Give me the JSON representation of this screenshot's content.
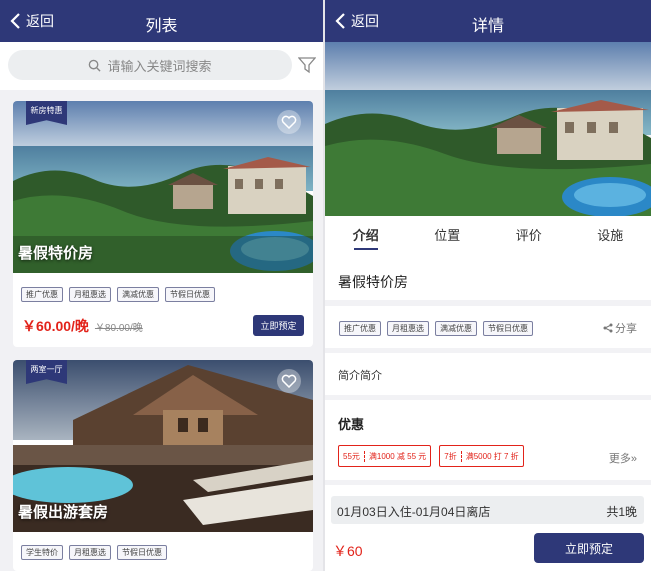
{
  "list_screen": {
    "back_label": "返回",
    "title": "列表",
    "search": {
      "placeholder": "请输入关键词搜索"
    },
    "rooms": [
      {
        "ribbon": "新房特惠",
        "name": "暑假特价房",
        "tags": [
          "推广优惠",
          "月租惠选",
          "满减优惠",
          "节假日优惠"
        ],
        "price": "￥60.00/晚",
        "original_price": "￥80.00/晚",
        "book_label": "立即预定"
      },
      {
        "ribbon": "两室一厅",
        "name": "暑假出游套房",
        "tags": [
          "学生特价",
          "月租惠选",
          "节假日优惠"
        ]
      }
    ]
  },
  "detail_screen": {
    "back_label": "返回",
    "title": "详情",
    "tabs": [
      "介绍",
      "位置",
      "评价",
      "设施"
    ],
    "active_tab": "介绍",
    "room_name": "暑假特价房",
    "tags": [
      "推广优惠",
      "月租惠选",
      "满减优惠",
      "节假日优惠"
    ],
    "share_label": "分享",
    "intro_text": "简介简介",
    "deals": {
      "title": "优惠",
      "coupons": [
        {
          "amount": "55元",
          "rule": "满1000 减 55 元"
        },
        {
          "amount": "7折",
          "rule": "满5000 打 7 折"
        }
      ],
      "more_label": "更多"
    },
    "stay": {
      "dates": "01月03日入住-01月04日离店",
      "nights": "共1晚"
    },
    "total_price": "￥60",
    "book_label": "立即预定"
  },
  "colors": {
    "brand": "#2e3878",
    "price": "#e2231a"
  }
}
